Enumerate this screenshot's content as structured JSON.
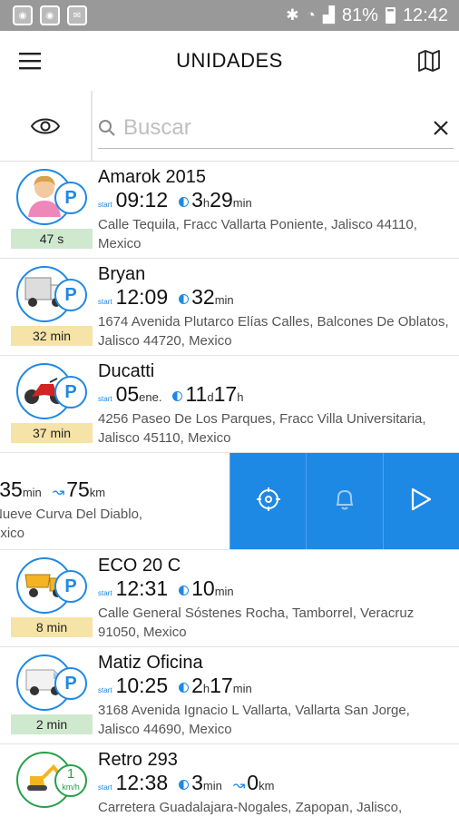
{
  "statusbar": {
    "battery": "81%",
    "time": "12:42"
  },
  "header": {
    "title": "UNIDADES"
  },
  "search": {
    "placeholder": "Buscar",
    "value": ""
  },
  "units": [
    {
      "name": "Amarok 2015",
      "start_label": "start",
      "start_time": "09:12",
      "start_suffix": "",
      "duration": [
        [
          "3",
          "h"
        ],
        [
          "29",
          "min"
        ]
      ],
      "distance": null,
      "address": "Calle Tequila, Fracc Vallarta Poniente, Jalisco 44110, Mexico",
      "age": "47 s",
      "age_color": "green",
      "status": "P",
      "icon": "person-icon"
    },
    {
      "name": "Bryan",
      "start_label": "start",
      "start_time": "12:09",
      "start_suffix": "",
      "duration": [
        [
          "32",
          "min"
        ]
      ],
      "distance": null,
      "address": "1674 Avenida Plutarco Elías Calles, Balcones De Oblatos, Jalisco 44720, Mexico",
      "age": "32 min",
      "age_color": "amber",
      "status": "P",
      "icon": "truck-icon"
    },
    {
      "name": "Ducatti",
      "start_label": "start",
      "start_time": "05",
      "start_suffix": "ene.",
      "duration": [
        [
          "11",
          "d"
        ],
        [
          "17",
          "h"
        ]
      ],
      "distance": null,
      "address": "4256 Paseo De Los Parques, Fracc Villa Universitaria, Jalisco 45110, Mexico",
      "age": "37 min",
      "age_color": "amber",
      "status": "P",
      "icon": "motorcycle-icon"
    },
    {
      "name": "",
      "start_label": "",
      "start_time": "",
      "start_suffix": "",
      "duration": [
        [
          "",
          "h"
        ],
        [
          "35",
          "min"
        ]
      ],
      "distance": "75",
      "distance_unit": "km",
      "address": "Nueve Curva Del Diablo,",
      "address2": "exico",
      "swiped": true
    },
    {
      "name": "ECO 20 C",
      "start_label": "start",
      "start_time": "12:31",
      "start_suffix": "",
      "duration": [
        [
          "10",
          "min"
        ]
      ],
      "distance": null,
      "address": "Calle General Sóstenes Rocha, Tamborrel, Veracruz 91050, Mexico",
      "age": "8 min",
      "age_color": "amber",
      "status": "P",
      "icon": "dump-truck-icon"
    },
    {
      "name": "Matiz Oficina",
      "start_label": "start",
      "start_time": "10:25",
      "start_suffix": "",
      "duration": [
        [
          "2",
          "h"
        ],
        [
          "17",
          "min"
        ]
      ],
      "distance": null,
      "address": "3168 Avenida Ignacio L Vallarta, Vallarta San Jorge, Jalisco 44690, Mexico",
      "age": "2 min",
      "age_color": "green",
      "status": "P",
      "icon": "van-icon"
    },
    {
      "name": "Retro 293",
      "start_label": "start",
      "start_time": "12:38",
      "start_suffix": "",
      "duration": [
        [
          "3",
          "min"
        ]
      ],
      "distance": "0",
      "distance_unit": "km",
      "address": "Carretera Guadalajara-Nogales, Zapopan, Jalisco,",
      "age": "",
      "age_color": "green",
      "status": "1",
      "status_unit": "km/h",
      "icon": "excavator-icon",
      "moving": true
    }
  ],
  "swipe_actions": [
    {
      "icon": "locate-icon"
    },
    {
      "icon": "bell-icon"
    },
    {
      "icon": "play-icon"
    }
  ],
  "colors": {
    "accent": "#1e88e5",
    "moving": "#26a04a",
    "fresh": "#cfe9cf",
    "stale": "#f5e3a8"
  }
}
